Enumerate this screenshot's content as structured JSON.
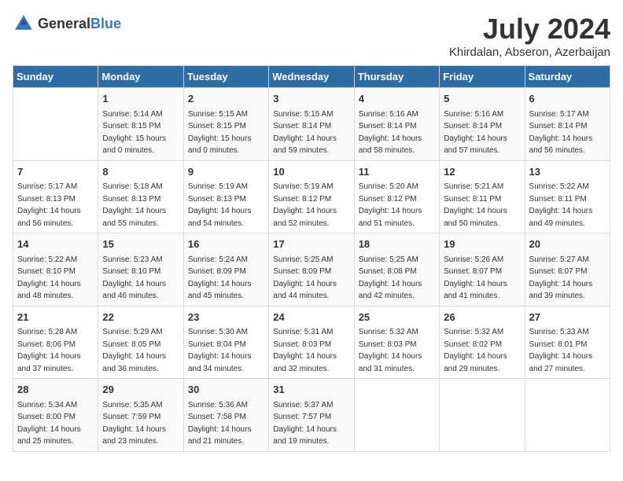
{
  "header": {
    "logo_general": "General",
    "logo_blue": "Blue",
    "month_year": "July 2024",
    "location": "Khirdalan, Abseron, Azerbaijan"
  },
  "days_of_week": [
    "Sunday",
    "Monday",
    "Tuesday",
    "Wednesday",
    "Thursday",
    "Friday",
    "Saturday"
  ],
  "weeks": [
    [
      {
        "day": "",
        "info": ""
      },
      {
        "day": "1",
        "info": "Sunrise: 5:14 AM\nSunset: 8:15 PM\nDaylight: 15 hours\nand 0 minutes."
      },
      {
        "day": "2",
        "info": "Sunrise: 5:15 AM\nSunset: 8:15 PM\nDaylight: 15 hours\nand 0 minutes."
      },
      {
        "day": "3",
        "info": "Sunrise: 5:15 AM\nSunset: 8:14 PM\nDaylight: 14 hours\nand 59 minutes."
      },
      {
        "day": "4",
        "info": "Sunrise: 5:16 AM\nSunset: 8:14 PM\nDaylight: 14 hours\nand 58 minutes."
      },
      {
        "day": "5",
        "info": "Sunrise: 5:16 AM\nSunset: 8:14 PM\nDaylight: 14 hours\nand 57 minutes."
      },
      {
        "day": "6",
        "info": "Sunrise: 5:17 AM\nSunset: 8:14 PM\nDaylight: 14 hours\nand 56 minutes."
      }
    ],
    [
      {
        "day": "7",
        "info": "Sunrise: 5:17 AM\nSunset: 8:13 PM\nDaylight: 14 hours\nand 56 minutes."
      },
      {
        "day": "8",
        "info": "Sunrise: 5:18 AM\nSunset: 8:13 PM\nDaylight: 14 hours\nand 55 minutes."
      },
      {
        "day": "9",
        "info": "Sunrise: 5:19 AM\nSunset: 8:13 PM\nDaylight: 14 hours\nand 54 minutes."
      },
      {
        "day": "10",
        "info": "Sunrise: 5:19 AM\nSunset: 8:12 PM\nDaylight: 14 hours\nand 52 minutes."
      },
      {
        "day": "11",
        "info": "Sunrise: 5:20 AM\nSunset: 8:12 PM\nDaylight: 14 hours\nand 51 minutes."
      },
      {
        "day": "12",
        "info": "Sunrise: 5:21 AM\nSunset: 8:11 PM\nDaylight: 14 hours\nand 50 minutes."
      },
      {
        "day": "13",
        "info": "Sunrise: 5:22 AM\nSunset: 8:11 PM\nDaylight: 14 hours\nand 49 minutes."
      }
    ],
    [
      {
        "day": "14",
        "info": "Sunrise: 5:22 AM\nSunset: 8:10 PM\nDaylight: 14 hours\nand 48 minutes."
      },
      {
        "day": "15",
        "info": "Sunrise: 5:23 AM\nSunset: 8:10 PM\nDaylight: 14 hours\nand 46 minutes."
      },
      {
        "day": "16",
        "info": "Sunrise: 5:24 AM\nSunset: 8:09 PM\nDaylight: 14 hours\nand 45 minutes."
      },
      {
        "day": "17",
        "info": "Sunrise: 5:25 AM\nSunset: 8:09 PM\nDaylight: 14 hours\nand 44 minutes."
      },
      {
        "day": "18",
        "info": "Sunrise: 5:25 AM\nSunset: 8:08 PM\nDaylight: 14 hours\nand 42 minutes."
      },
      {
        "day": "19",
        "info": "Sunrise: 5:26 AM\nSunset: 8:07 PM\nDaylight: 14 hours\nand 41 minutes."
      },
      {
        "day": "20",
        "info": "Sunrise: 5:27 AM\nSunset: 8:07 PM\nDaylight: 14 hours\nand 39 minutes."
      }
    ],
    [
      {
        "day": "21",
        "info": "Sunrise: 5:28 AM\nSunset: 8:06 PM\nDaylight: 14 hours\nand 37 minutes."
      },
      {
        "day": "22",
        "info": "Sunrise: 5:29 AM\nSunset: 8:05 PM\nDaylight: 14 hours\nand 36 minutes."
      },
      {
        "day": "23",
        "info": "Sunrise: 5:30 AM\nSunset: 8:04 PM\nDaylight: 14 hours\nand 34 minutes."
      },
      {
        "day": "24",
        "info": "Sunrise: 5:31 AM\nSunset: 8:03 PM\nDaylight: 14 hours\nand 32 minutes."
      },
      {
        "day": "25",
        "info": "Sunrise: 5:32 AM\nSunset: 8:03 PM\nDaylight: 14 hours\nand 31 minutes."
      },
      {
        "day": "26",
        "info": "Sunrise: 5:32 AM\nSunset: 8:02 PM\nDaylight: 14 hours\nand 29 minutes."
      },
      {
        "day": "27",
        "info": "Sunrise: 5:33 AM\nSunset: 8:01 PM\nDaylight: 14 hours\nand 27 minutes."
      }
    ],
    [
      {
        "day": "28",
        "info": "Sunrise: 5:34 AM\nSunset: 8:00 PM\nDaylight: 14 hours\nand 25 minutes."
      },
      {
        "day": "29",
        "info": "Sunrise: 5:35 AM\nSunset: 7:59 PM\nDaylight: 14 hours\nand 23 minutes."
      },
      {
        "day": "30",
        "info": "Sunrise: 5:36 AM\nSunset: 7:58 PM\nDaylight: 14 hours\nand 21 minutes."
      },
      {
        "day": "31",
        "info": "Sunrise: 5:37 AM\nSunset: 7:57 PM\nDaylight: 14 hours\nand 19 minutes."
      },
      {
        "day": "",
        "info": ""
      },
      {
        "day": "",
        "info": ""
      },
      {
        "day": "",
        "info": ""
      }
    ]
  ]
}
